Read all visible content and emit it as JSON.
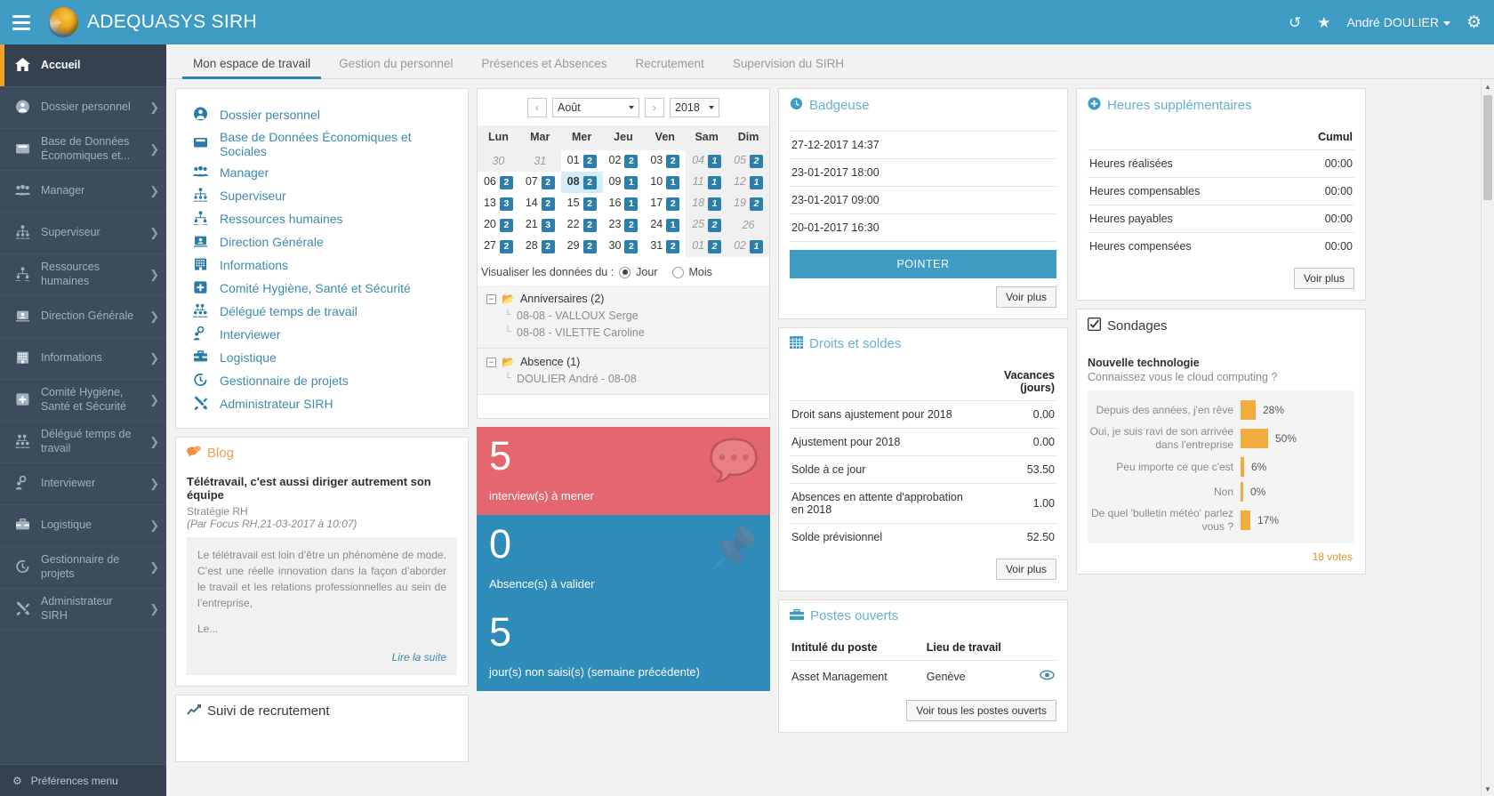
{
  "topbar": {
    "brand": "ADEQUASYS SIRH",
    "menu_icon": "hamburger-icon",
    "history_icon": "↺",
    "star_icon": "★",
    "user": "André DOULIER",
    "gear_icon": "⚙"
  },
  "sidebar": {
    "home": {
      "label": "Accueil",
      "icon": "🏠"
    },
    "items": [
      {
        "label": "Dossier personnel",
        "icon": "person"
      },
      {
        "label": "Base de Données Économiques et...",
        "icon": "folder"
      },
      {
        "label": "Manager",
        "icon": "group"
      },
      {
        "label": "Superviseur",
        "icon": "org"
      },
      {
        "label": "Ressources humaines",
        "icon": "hr"
      },
      {
        "label": "Direction Générale",
        "icon": "dg"
      },
      {
        "label": "Informations",
        "icon": "building"
      },
      {
        "label": "Comité Hygiène, Santé et Sécurité",
        "icon": "plus-square"
      },
      {
        "label": "Délégué temps de travail",
        "icon": "delegate"
      },
      {
        "label": "Interviewer",
        "icon": "interview"
      },
      {
        "label": "Logistique",
        "icon": "briefcase"
      },
      {
        "label": "Gestionnaire de projets",
        "icon": "clock-arrow"
      },
      {
        "label": "Administrateur SIRH",
        "icon": "tools"
      }
    ],
    "footer": {
      "label": "Préférences menu",
      "icon": "⚙"
    },
    "arrow": "❯"
  },
  "tabs": [
    {
      "label": "Mon espace de travail",
      "active": true
    },
    {
      "label": "Gestion du personnel",
      "active": false
    },
    {
      "label": "Présences et Absences",
      "active": false
    },
    {
      "label": "Recrutement",
      "active": false
    },
    {
      "label": "Supervision du SIRH",
      "active": false
    }
  ],
  "links_card": {
    "items": [
      {
        "label": "Dossier personnel",
        "icon": "person"
      },
      {
        "label": "Base de Données Économiques et Sociales",
        "icon": "folder"
      },
      {
        "label": "Manager",
        "icon": "group"
      },
      {
        "label": "Superviseur",
        "icon": "org"
      },
      {
        "label": "Ressources humaines",
        "icon": "hr"
      },
      {
        "label": "Direction Générale",
        "icon": "dg"
      },
      {
        "label": "Informations",
        "icon": "building"
      },
      {
        "label": "Comité Hygiène, Santé et Sécurité",
        "icon": "plus-square"
      },
      {
        "label": "Délégué temps de travail",
        "icon": "delegate"
      },
      {
        "label": "Interviewer",
        "icon": "interview"
      },
      {
        "label": "Logistique",
        "icon": "briefcase"
      },
      {
        "label": "Gestionnaire de projets",
        "icon": "clock-arrow"
      },
      {
        "label": "Administrateur SIRH",
        "icon": "tools"
      }
    ]
  },
  "blog": {
    "title": "Blog",
    "icon": "comments-icon",
    "post_title": "Télétravail, c'est aussi diriger autrement son équipe",
    "category": "Stratégie RH",
    "meta": "(Par Focus RH,21-03-2017 à 10:07)",
    "excerpt": "Le télétravail est loin d’être un phénomène de mode. C’est une réelle innovation dans la façon d’aborder le travail et les relations professionnelles au sein de l’entreprise,",
    "excerpt_more": "Le...",
    "read_more": "Lire la suite"
  },
  "recruitment": {
    "title": "Suivi de recrutement",
    "icon": "chart-line-icon"
  },
  "calendar": {
    "month": "Août",
    "year": "2018",
    "prev": "‹",
    "next": "›",
    "daynames": [
      "Lun",
      "Mar",
      "Mer",
      "Jeu",
      "Ven",
      "Sam",
      "Dim"
    ],
    "weeks": [
      [
        {
          "d": "30",
          "b": "",
          "out": true
        },
        {
          "d": "31",
          "b": "",
          "out": true
        },
        {
          "d": "01",
          "b": "2"
        },
        {
          "d": "02",
          "b": "2"
        },
        {
          "d": "03",
          "b": "2"
        },
        {
          "d": "04",
          "b": "1",
          "out": true,
          "we": true
        },
        {
          "d": "05",
          "b": "2",
          "out": true,
          "we": true
        }
      ],
      [
        {
          "d": "06",
          "b": "2"
        },
        {
          "d": "07",
          "b": "2"
        },
        {
          "d": "08",
          "b": "2",
          "selected": true
        },
        {
          "d": "09",
          "b": "1"
        },
        {
          "d": "10",
          "b": "1"
        },
        {
          "d": "11",
          "b": "1",
          "out": true,
          "we": true
        },
        {
          "d": "12",
          "b": "1",
          "out": true,
          "we": true
        }
      ],
      [
        {
          "d": "13",
          "b": "3"
        },
        {
          "d": "14",
          "b": "2"
        },
        {
          "d": "15",
          "b": "2"
        },
        {
          "d": "16",
          "b": "1"
        },
        {
          "d": "17",
          "b": "2"
        },
        {
          "d": "18",
          "b": "1",
          "out": true,
          "we": true
        },
        {
          "d": "19",
          "b": "2",
          "out": true,
          "we": true
        }
      ],
      [
        {
          "d": "20",
          "b": "2"
        },
        {
          "d": "21",
          "b": "3"
        },
        {
          "d": "22",
          "b": "2"
        },
        {
          "d": "23",
          "b": "2"
        },
        {
          "d": "24",
          "b": "1"
        },
        {
          "d": "25",
          "b": "2",
          "out": true,
          "we": true
        },
        {
          "d": "26",
          "b": "",
          "out": true,
          "we": true
        }
      ],
      [
        {
          "d": "27",
          "b": "2"
        },
        {
          "d": "28",
          "b": "2"
        },
        {
          "d": "29",
          "b": "2"
        },
        {
          "d": "30",
          "b": "2"
        },
        {
          "d": "31",
          "b": "2"
        },
        {
          "d": "01",
          "b": "2",
          "out": true,
          "we": true
        },
        {
          "d": "02",
          "b": "1",
          "out": true,
          "we": true
        }
      ]
    ],
    "visualize_label": "Visualiser les données du :",
    "option_day": "Jour",
    "option_month": "Mois",
    "groups": [
      {
        "label": "Anniversaires (2)",
        "items": [
          "08-08 - VALLOUX Serge",
          "08-08 - VILETTE Caroline"
        ]
      },
      {
        "label": "Absence (1)",
        "items": [
          "DOULIER André - 08-08"
        ]
      }
    ]
  },
  "tiles": [
    {
      "num": "5",
      "label": "interview(s) à mener",
      "color": "red",
      "watermark": "speech-bubble-icon"
    },
    {
      "num": "0",
      "label": "Absence(s) à valider",
      "color": "blue",
      "watermark": "pin-icon"
    },
    {
      "num": "5",
      "label": "jour(s) non saisi(s) (semaine précédente)",
      "color": "blue",
      "watermark": ""
    }
  ],
  "badgeuse": {
    "title": "Badgeuse",
    "icon": "clock-icon",
    "entries": [
      "27-12-2017 14:37",
      "23-01-2017 18:00",
      "23-01-2017 09:00",
      "20-01-2017 16:30"
    ],
    "button": "POINTER",
    "more": "Voir plus"
  },
  "droits": {
    "title": "Droits et soldes",
    "icon": "table-icon",
    "col_header": "Vacances (jours)",
    "rows": [
      {
        "label": "Droit sans ajustement pour 2018",
        "value": "0.00"
      },
      {
        "label": "Ajustement pour 2018",
        "value": "0.00"
      },
      {
        "label": "Solde à ce jour",
        "value": "53.50"
      },
      {
        "label": "Absences en attente d'approbation en 2018",
        "value": "1.00"
      },
      {
        "label": "Solde prévisionnel",
        "value": "52.50"
      }
    ],
    "more": "Voir plus"
  },
  "postes": {
    "title": "Postes ouverts",
    "icon": "briefcase-icon",
    "headers": [
      "Intitulé du poste",
      "Lieu de travail",
      ""
    ],
    "rows": [
      {
        "poste": "Asset Management",
        "lieu": "Genève",
        "action": "eye-icon"
      }
    ],
    "button": "Voir tous les postes ouverts"
  },
  "heures": {
    "title": "Heures supplémentaires",
    "icon": "plus-circle-icon",
    "col_header": "Cumul",
    "rows": [
      {
        "label": "Heures réalisées",
        "value": "00:00"
      },
      {
        "label": "Heures compensables",
        "value": "00:00"
      },
      {
        "label": "Heures payables",
        "value": "00:00"
      },
      {
        "label": "Heures compensées",
        "value": "00:00"
      }
    ],
    "more": "Voir plus"
  },
  "sondages": {
    "title": "Sondages",
    "icon": "check-square-icon",
    "poll_title": "Nouvelle technologie",
    "question": "Connaissez vous le cloud computing ?",
    "votes": "18 votes"
  },
  "chart_data": {
    "type": "bar",
    "title": "Nouvelle technologie",
    "subtitle": "Connaissez vous le cloud computing ?",
    "categories": [
      "Depuis des années, j'en rêve",
      "Oui, je suis ravi de son arrivée dans l'entreprise",
      "Peu importe ce que c'est",
      "Non",
      "De quel 'bulletin météo' parlez vous ?"
    ],
    "values": [
      28,
      50,
      6,
      0,
      17
    ],
    "labels": [
      "28%",
      "50%",
      "6%",
      "0%",
      "17%"
    ],
    "unit": "%",
    "xlabel": "",
    "ylabel": "",
    "xlim": [
      0,
      100
    ],
    "grid": false,
    "legend": "none",
    "orientation": "horizontal",
    "bar_color": "#f0ad3e",
    "total_votes": "18 votes"
  }
}
